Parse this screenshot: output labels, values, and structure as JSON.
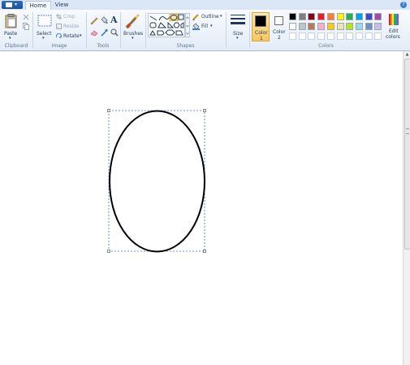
{
  "tabs": [
    {
      "label": "Home",
      "active": true
    },
    {
      "label": "View",
      "active": false
    }
  ],
  "help_glyph": "?",
  "clipboard": {
    "paste_label": "Paste",
    "group_label": "Clipboard"
  },
  "image": {
    "select_label": "Select",
    "crop_label": "Crop",
    "resize_label": "Resize",
    "rotate_label": "Rotate",
    "group_label": "Image"
  },
  "tools": {
    "group_label": "Tools",
    "text_tool_glyph": "A"
  },
  "brushes": {
    "label": "Brushes"
  },
  "shapes": {
    "outline_label": "Outline",
    "fill_label": "Fill",
    "group_label": "Shapes"
  },
  "size": {
    "label": "Size"
  },
  "colors": {
    "color1_label": "Color",
    "color1_index": "1",
    "color2_label": "Color",
    "color2_index": "2",
    "color1": "#000000",
    "color2": "#ffffff",
    "edit_label_1": "Edit",
    "edit_label_2": "colors",
    "group_label": "Colors",
    "palette_row1": [
      "#000000",
      "#7f7f7f",
      "#880015",
      "#ed1c24",
      "#ff7f27",
      "#fff200",
      "#22b14c",
      "#00a2e8",
      "#3f48cc",
      "#a349a4"
    ],
    "palette_row2": [
      "#ffffff",
      "#c3c3c3",
      "#b97a57",
      "#ffaec9",
      "#ffc90e",
      "#efe4b0",
      "#b5e61d",
      "#99d9ea",
      "#7092be",
      "#c8bfe7"
    ]
  },
  "canvas": {
    "shape": "ellipse",
    "stroke_color": "#000000",
    "selection_color": "#3c78c8"
  }
}
